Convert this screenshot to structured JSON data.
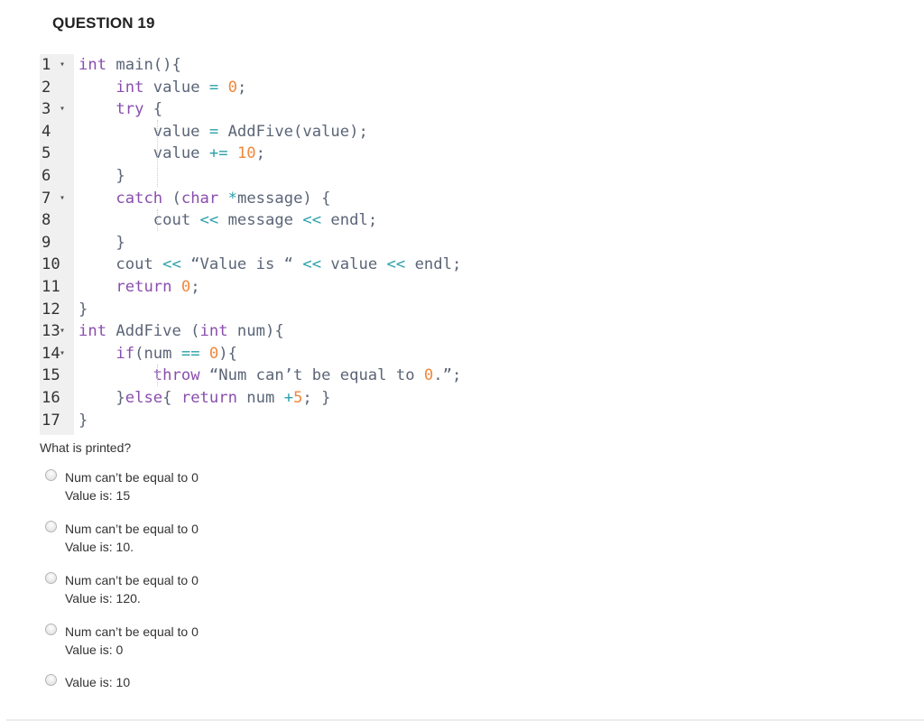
{
  "question": {
    "title": "QUESTION 19",
    "prompt": "What is printed?"
  },
  "code": {
    "lines": [
      {
        "n": "1",
        "fold": true
      },
      {
        "n": "2",
        "fold": false
      },
      {
        "n": "3",
        "fold": true
      },
      {
        "n": "4",
        "fold": false
      },
      {
        "n": "5",
        "fold": false
      },
      {
        "n": "6",
        "fold": false
      },
      {
        "n": "7",
        "fold": true
      },
      {
        "n": "8",
        "fold": false
      },
      {
        "n": "9",
        "fold": false
      },
      {
        "n": "10",
        "fold": false
      },
      {
        "n": "11",
        "fold": false
      },
      {
        "n": "12",
        "fold": false
      },
      {
        "n": "13",
        "fold": true
      },
      {
        "n": "14",
        "fold": true
      },
      {
        "n": "15",
        "fold": false
      },
      {
        "n": "16",
        "fold": false
      },
      {
        "n": "17",
        "fold": false
      }
    ],
    "tokens": [
      [
        [
          "kw",
          "int"
        ],
        [
          "t",
          " main(){"
        ]
      ],
      [
        [
          "t",
          "    "
        ],
        [
          "kw",
          "int"
        ],
        [
          "t",
          " value "
        ],
        [
          "op",
          "="
        ],
        [
          "t",
          " "
        ],
        [
          "num",
          "0"
        ],
        [
          "t",
          ";"
        ]
      ],
      [
        [
          "t",
          "    "
        ],
        [
          "kw",
          "try"
        ],
        [
          "t",
          " {"
        ]
      ],
      [
        [
          "t",
          "        value "
        ],
        [
          "op",
          "="
        ],
        [
          "t",
          " AddFive(value);"
        ]
      ],
      [
        [
          "t",
          "        value "
        ],
        [
          "op",
          "+="
        ],
        [
          "t",
          " "
        ],
        [
          "num",
          "10"
        ],
        [
          "t",
          ";"
        ]
      ],
      [
        [
          "t",
          "    }"
        ]
      ],
      [
        [
          "t",
          "    "
        ],
        [
          "kw",
          "catch"
        ],
        [
          "t",
          " ("
        ],
        [
          "kw",
          "char"
        ],
        [
          "t",
          " "
        ],
        [
          "op",
          "*"
        ],
        [
          "t",
          "message) {"
        ]
      ],
      [
        [
          "t",
          "        cout "
        ],
        [
          "op",
          "<<"
        ],
        [
          "t",
          " message "
        ],
        [
          "op",
          "<<"
        ],
        [
          "t",
          " endl;"
        ]
      ],
      [
        [
          "t",
          "    }"
        ]
      ],
      [
        [
          "t",
          "    cout "
        ],
        [
          "op",
          "<<"
        ],
        [
          "t",
          " “Value is “ "
        ],
        [
          "op",
          "<<"
        ],
        [
          "t",
          " value "
        ],
        [
          "op",
          "<<"
        ],
        [
          "t",
          " endl;"
        ]
      ],
      [
        [
          "t",
          "    "
        ],
        [
          "kw",
          "return"
        ],
        [
          "t",
          " "
        ],
        [
          "num",
          "0"
        ],
        [
          "t",
          ";"
        ]
      ],
      [
        [
          "t",
          "}"
        ]
      ],
      [
        [
          "kw",
          "int"
        ],
        [
          "t",
          " AddFive ("
        ],
        [
          "kw",
          "int"
        ],
        [
          "t",
          " num){"
        ]
      ],
      [
        [
          "t",
          "    "
        ],
        [
          "kw",
          "if"
        ],
        [
          "t",
          "(num "
        ],
        [
          "op",
          "=="
        ],
        [
          "t",
          " "
        ],
        [
          "num",
          "0"
        ],
        [
          "t",
          "){"
        ]
      ],
      [
        [
          "t",
          "        "
        ],
        [
          "kw",
          "throw"
        ],
        [
          "t",
          " “Num can’t be equal to "
        ],
        [
          "num",
          "0"
        ],
        [
          "t",
          ".”;"
        ]
      ],
      [
        [
          "t",
          "    }"
        ],
        [
          "kw",
          "else"
        ],
        [
          "t",
          "{ "
        ],
        [
          "kw",
          "return"
        ],
        [
          "t",
          " num "
        ],
        [
          "op",
          "+"
        ],
        [
          "num",
          "5"
        ],
        [
          "t",
          "; }"
        ]
      ],
      [
        [
          "t",
          "}"
        ]
      ]
    ]
  },
  "options": [
    {
      "line1": "Num can’t be equal to 0",
      "line2": "Value is: 15",
      "selected": false
    },
    {
      "line1": "Num can’t be equal to 0",
      "line2": "Value is: 10.",
      "selected": false
    },
    {
      "line1": "Num can’t be equal to 0",
      "line2": "Value is: 120.",
      "selected": false
    },
    {
      "line1": "Num can’t be equal to 0",
      "line2": "Value is: 0",
      "selected": false
    },
    {
      "line1": "Value is: 10",
      "line2": "",
      "selected": false
    }
  ],
  "colors": {
    "keyword": "#8a4eae",
    "number": "#f0883a",
    "operator": "#2aa0a8",
    "text": "#5b6577",
    "gutter": "#f0f0f0"
  }
}
